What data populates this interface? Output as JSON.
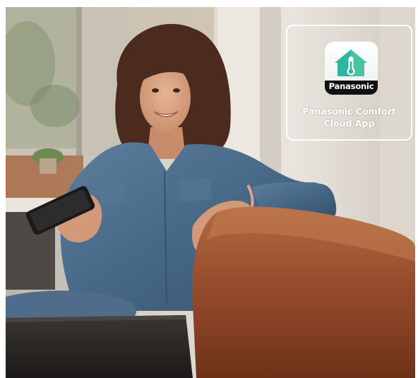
{
  "app_badge": {
    "brand_label": "Panasonic",
    "title_line1": "Panasonic Comfort",
    "title_line2": "Cloud App",
    "icon": "house-thermometer-icon",
    "accent_color": "#2fb5a3"
  },
  "photo": {
    "subject": "smiling woman holding a smartphone on a leather sofa",
    "main_colors": {
      "denim": "#4d6f8f",
      "sofa": "#9a4e2c",
      "background": "#d9d5cc"
    }
  }
}
